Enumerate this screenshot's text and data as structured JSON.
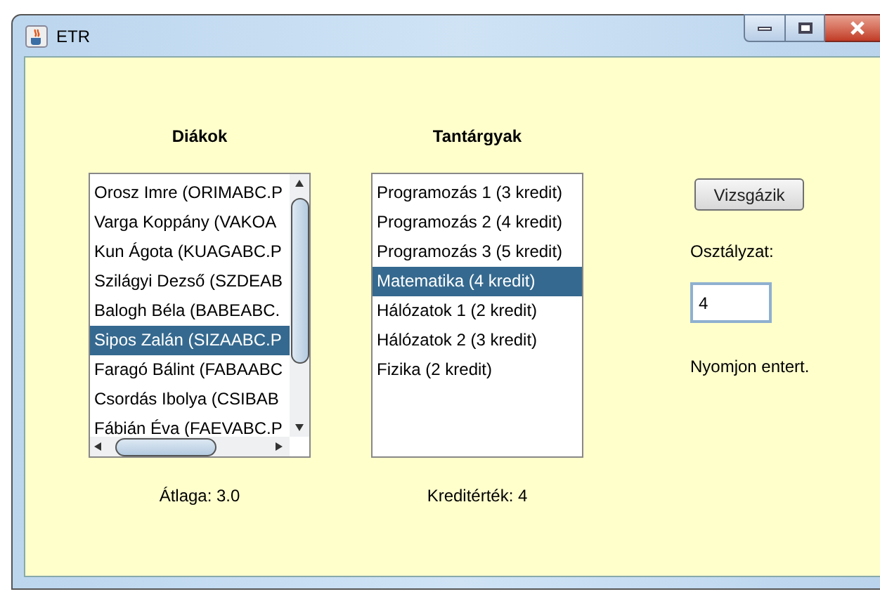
{
  "window": {
    "title": "ETR"
  },
  "students": {
    "heading": "Diákok",
    "items": [
      {
        "label": "Orosz Imre (ORIMABC.P",
        "selected": false
      },
      {
        "label": "Varga Koppány (VAKOA",
        "selected": false
      },
      {
        "label": "Kun Ágota (KUAGABC.P",
        "selected": false
      },
      {
        "label": "Szilágyi Dezső (SZDEAB",
        "selected": false
      },
      {
        "label": "Balogh Béla (BABEABC.",
        "selected": false
      },
      {
        "label": "Sipos Zalán (SIZAABC.P",
        "selected": true
      },
      {
        "label": "Faragó Bálint (FABAABC",
        "selected": false
      },
      {
        "label": "Csordás Ibolya (CSIBAB",
        "selected": false
      },
      {
        "label": "Fábián Éva (FAEVABC.P",
        "selected": false
      }
    ],
    "caption": "Átlaga: 3.0"
  },
  "subjects": {
    "heading": "Tantárgyak",
    "items": [
      {
        "label": "Programozás 1 (3 kredit)",
        "selected": false
      },
      {
        "label": "Programozás 2 (4 kredit)",
        "selected": false
      },
      {
        "label": "Programozás 3 (5 kredit)",
        "selected": false
      },
      {
        "label": "Matematika (4 kredit)",
        "selected": true
      },
      {
        "label": "Hálózatok 1 (2 kredit)",
        "selected": false
      },
      {
        "label": "Hálózatok 2 (3 kredit)",
        "selected": false
      },
      {
        "label": "Fizika (2 kredit)",
        "selected": false
      }
    ],
    "caption": "Kreditérték: 4"
  },
  "exam": {
    "button": "Vizsgázik",
    "grade_label": "Osztályzat:",
    "grade_value": "4",
    "hint": "Nyomjon entert."
  }
}
